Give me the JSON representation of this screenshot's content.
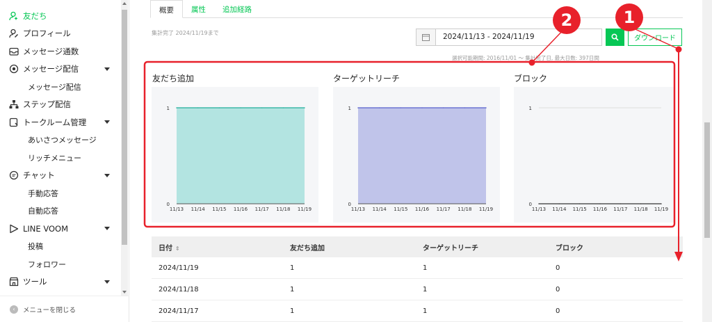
{
  "sidebar": {
    "items": [
      {
        "label": "友だち",
        "icon": "user-add-icon",
        "active": true
      },
      {
        "label": "プロフィール",
        "icon": "user-edit-icon"
      },
      {
        "label": "メッセージ通数",
        "icon": "inbox-icon"
      },
      {
        "label": "メッセージ配信",
        "icon": "broadcast-icon",
        "caret": true
      },
      {
        "label": "ステップ配信",
        "icon": "hierarchy-icon"
      },
      {
        "label": "トークルーム管理",
        "icon": "talkroom-icon",
        "caret": true
      },
      {
        "label": "チャット",
        "icon": "chat-bubble-icon",
        "caret": true
      },
      {
        "label": "LINE VOOM",
        "icon": "play-icon",
        "caret": true
      },
      {
        "label": "ツール",
        "icon": "shop-icon",
        "caret": true
      }
    ],
    "subs": {
      "broadcast": [
        "メッセージ配信"
      ],
      "talkroom": [
        "あいさつメッセージ",
        "リッチメニュー"
      ],
      "chat": [
        "手動応答",
        "自動応答"
      ],
      "voom": [
        "投稿",
        "フォロワー"
      ]
    },
    "close_label": "メニューを閉じる"
  },
  "tabs": [
    "概要",
    "属性",
    "追加経路"
  ],
  "aggregation_note": "集計完了 2024/11/19まで",
  "date_range": "2024/11/13 - 2024/11/19",
  "download_label": "ダウンロード",
  "period_note": "選択可能期間: 2016/11/01 〜 集計完了日, 最大日数: 397日間",
  "colors": {
    "accent": "#06c755",
    "friends_fill": "#b3e4e1",
    "friends_line": "#3db8a8",
    "reach_fill": "#c0c4ea",
    "reach_line": "#6d74d2",
    "block_line": "#555555",
    "annotation_red": "#e8212b"
  },
  "chart_data": [
    {
      "type": "area",
      "title": "友だち追加",
      "x": [
        "11/13",
        "11/14",
        "11/15",
        "11/16",
        "11/17",
        "11/18",
        "11/19"
      ],
      "values": [
        1,
        1,
        1,
        1,
        1,
        1,
        1
      ],
      "y_ticks": [
        0,
        1
      ],
      "ylim": [
        0,
        1
      ]
    },
    {
      "type": "area",
      "title": "ターゲットリーチ",
      "x": [
        "11/13",
        "11/14",
        "11/15",
        "11/16",
        "11/17",
        "11/18",
        "11/19"
      ],
      "values": [
        1,
        1,
        1,
        1,
        1,
        1,
        1
      ],
      "y_ticks": [
        0,
        1
      ],
      "ylim": [
        0,
        1
      ]
    },
    {
      "type": "line",
      "title": "ブロック",
      "x": [
        "11/13",
        "11/14",
        "11/15",
        "11/16",
        "11/17",
        "11/18",
        "11/19"
      ],
      "values": [
        0,
        0,
        0,
        0,
        0,
        0,
        0
      ],
      "y_ticks": [
        0,
        1
      ],
      "ylim": [
        0,
        1
      ]
    }
  ],
  "table": {
    "headers": [
      "日付",
      "友だち追加",
      "ターゲットリーチ",
      "ブロック"
    ],
    "rows": [
      [
        "2024/11/19",
        "1",
        "1",
        "0"
      ],
      [
        "2024/11/18",
        "1",
        "1",
        "0"
      ],
      [
        "2024/11/17",
        "1",
        "1",
        "0"
      ]
    ]
  },
  "annotations": {
    "badge1": "1",
    "badge2": "2"
  }
}
